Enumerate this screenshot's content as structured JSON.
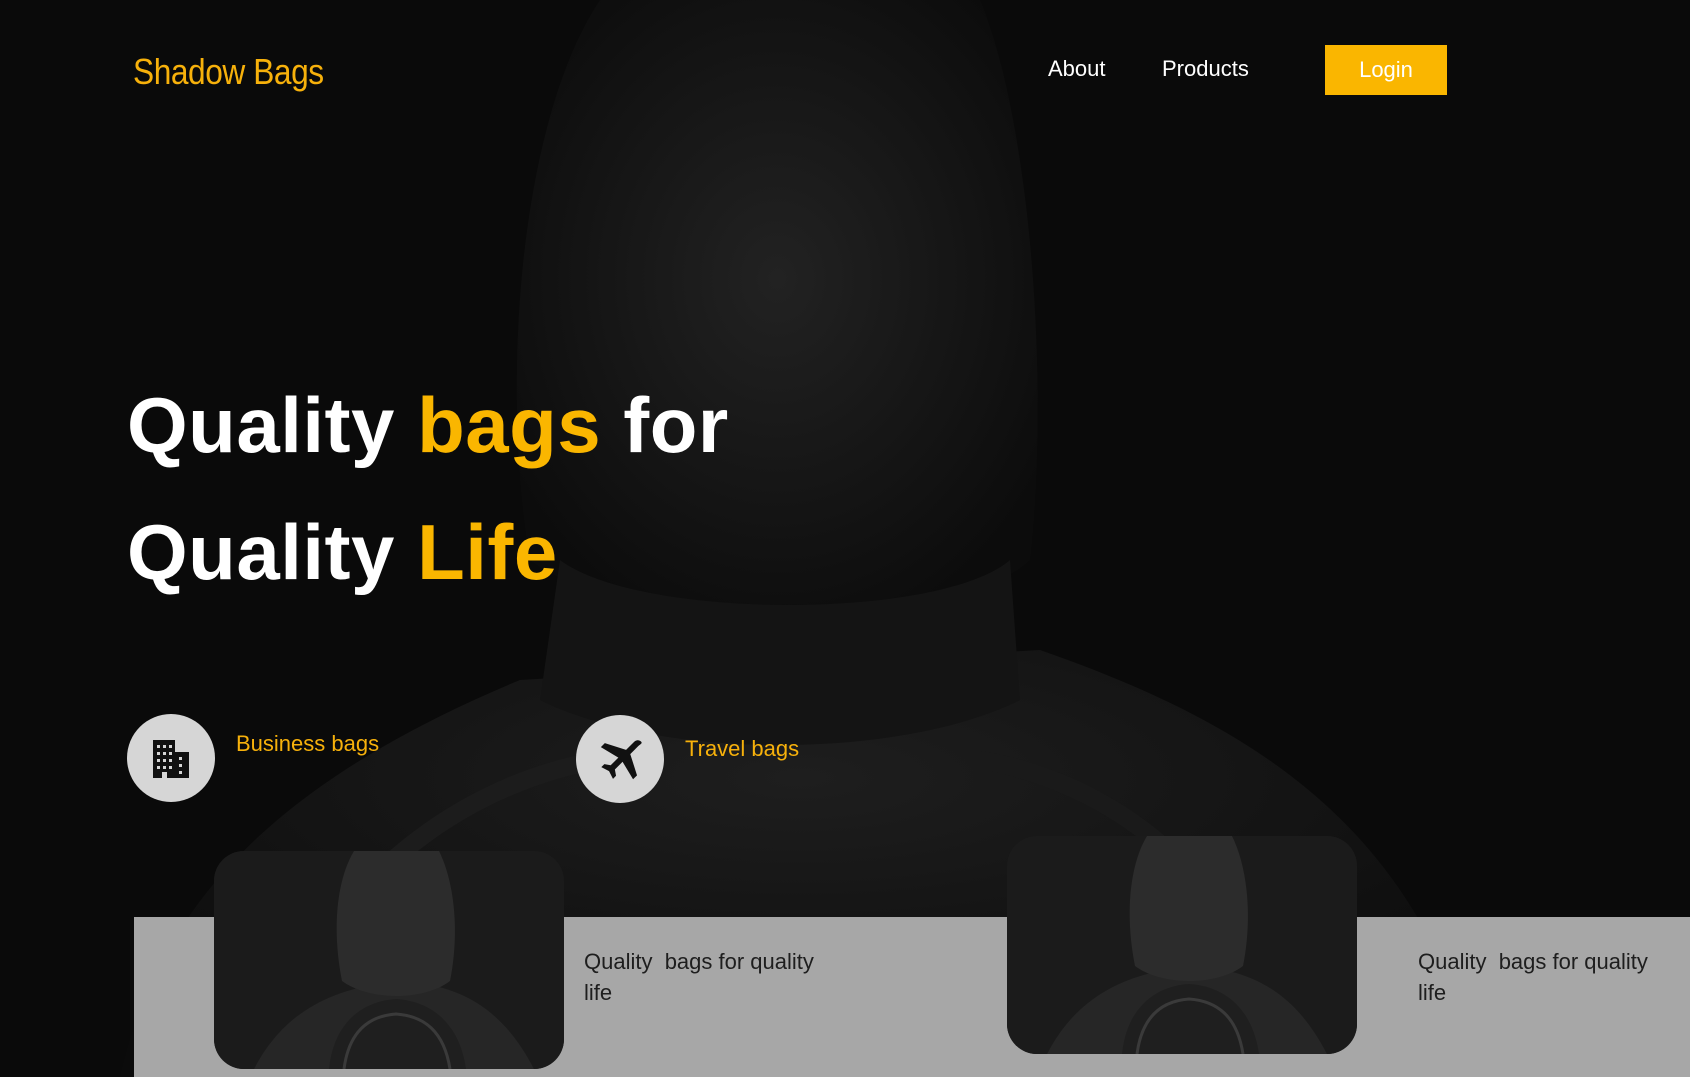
{
  "brand": {
    "name": "Shadow Bags",
    "accent_color": "#fab600"
  },
  "nav": {
    "about": "About",
    "products": "Products",
    "login": "Login"
  },
  "hero": {
    "line1": {
      "part1": "Quality ",
      "accent": "bags",
      "part2": " for"
    },
    "line2": {
      "part1": "Quality ",
      "accent": "Life"
    }
  },
  "categories": [
    {
      "label": "Business bags",
      "icon": "building-icon"
    },
    {
      "label": "Travel bags",
      "icon": "airplane-icon"
    }
  ],
  "cards": [
    {
      "text": "Quality  bags for quality life",
      "image": "hooded-figure-backpack-image"
    },
    {
      "text": "Quality  bags for quality life",
      "image": "hooded-figure-backpack-image"
    }
  ]
}
